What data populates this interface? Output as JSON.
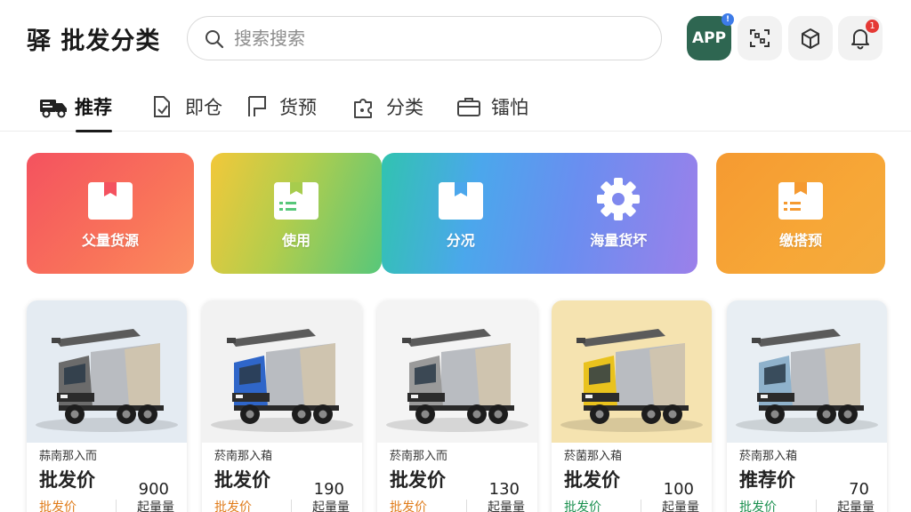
{
  "header": {
    "brand": "驿 批发分类",
    "search_placeholder": "搜索搜索",
    "app_label": "APP",
    "app_badge": "!",
    "bell_badge": "1"
  },
  "tabs": [
    {
      "label": "推荐",
      "icon": "truck-icon",
      "active": true
    },
    {
      "label": "即仓",
      "icon": "document-icon",
      "active": false
    },
    {
      "label": "货预",
      "icon": "flag-icon",
      "active": false
    },
    {
      "label": "分类",
      "icon": "puzzle-icon",
      "active": false
    },
    {
      "label": "镭怕",
      "icon": "briefcase-icon",
      "active": false
    }
  ],
  "categories": [
    {
      "label": "父量货源",
      "icon": "box-icon"
    },
    {
      "label": "使用",
      "icon": "box-list-icon"
    },
    {
      "label": "分况",
      "icon": "box-icon"
    },
    {
      "label": "海量货坏",
      "icon": "gear-icon"
    },
    {
      "label": "缴搭预",
      "icon": "box-list-icon"
    }
  ],
  "products": [
    {
      "name": "蒜南那入而",
      "title": "批发价",
      "price": "900",
      "price_label": "批发价",
      "moq": "起量量",
      "cab_color": "#6b6b6b",
      "bg": "#e4ebf2"
    },
    {
      "name": "菸南那入葙",
      "title": "批发价",
      "price": "190",
      "price_label": "批发价",
      "moq": "起量量",
      "cab_color": "#2f66c9",
      "bg": "#f2f2f2"
    },
    {
      "name": "菸南那入而",
      "title": "批发价",
      "price": "130",
      "price_label": "批发价",
      "moq": "起量量",
      "cab_color": "#9a9a9a",
      "bg": "#f4f4f4"
    },
    {
      "name": "菸菌那入葙",
      "title": "批发价",
      "price": "100",
      "price_label": "批发价",
      "moq": "起量量",
      "cab_color": "#e9c21d",
      "bg": "#f5e3b0"
    },
    {
      "name": "菸南那入葙",
      "title": "推荐价",
      "price": "70",
      "price_label": "批发价",
      "moq": "起量量",
      "cab_color": "#8fb2cc",
      "bg": "#e8eef3"
    }
  ]
}
